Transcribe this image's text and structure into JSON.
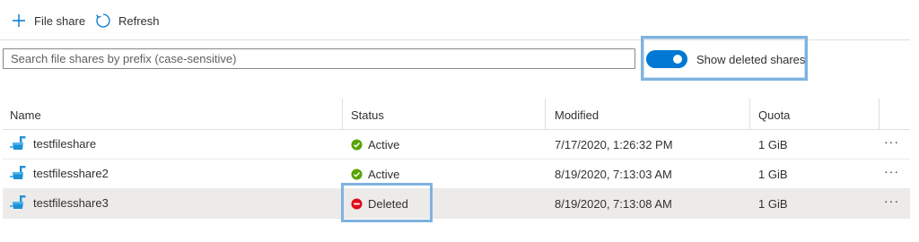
{
  "toolbar": {
    "file_share_label": "File share",
    "refresh_label": "Refresh"
  },
  "search": {
    "placeholder": "Search file shares by prefix (case-sensitive)",
    "value": ""
  },
  "toggle": {
    "label": "Show deleted shares",
    "on": true
  },
  "table": {
    "columns": [
      "Name",
      "Status",
      "Modified",
      "Quota"
    ],
    "rows": [
      {
        "name": "testfileshare",
        "status": "Active",
        "modified": "7/17/2020, 1:26:32 PM",
        "quota": "1 GiB",
        "more": "···"
      },
      {
        "name": "testfilesshare2",
        "status": "Active",
        "modified": "8/19/2020, 7:13:03 AM",
        "quota": "1 GiB",
        "more": "···"
      },
      {
        "name": "testfilesshare3",
        "status": "Deleted",
        "modified": "8/19/2020, 7:13:08 AM",
        "quota": "1 GiB",
        "more": "···"
      }
    ]
  },
  "colors": {
    "accent": "#0078d4",
    "active": "#57a300",
    "deleted": "#e00b1c",
    "highlight": "#7fb2e0"
  }
}
